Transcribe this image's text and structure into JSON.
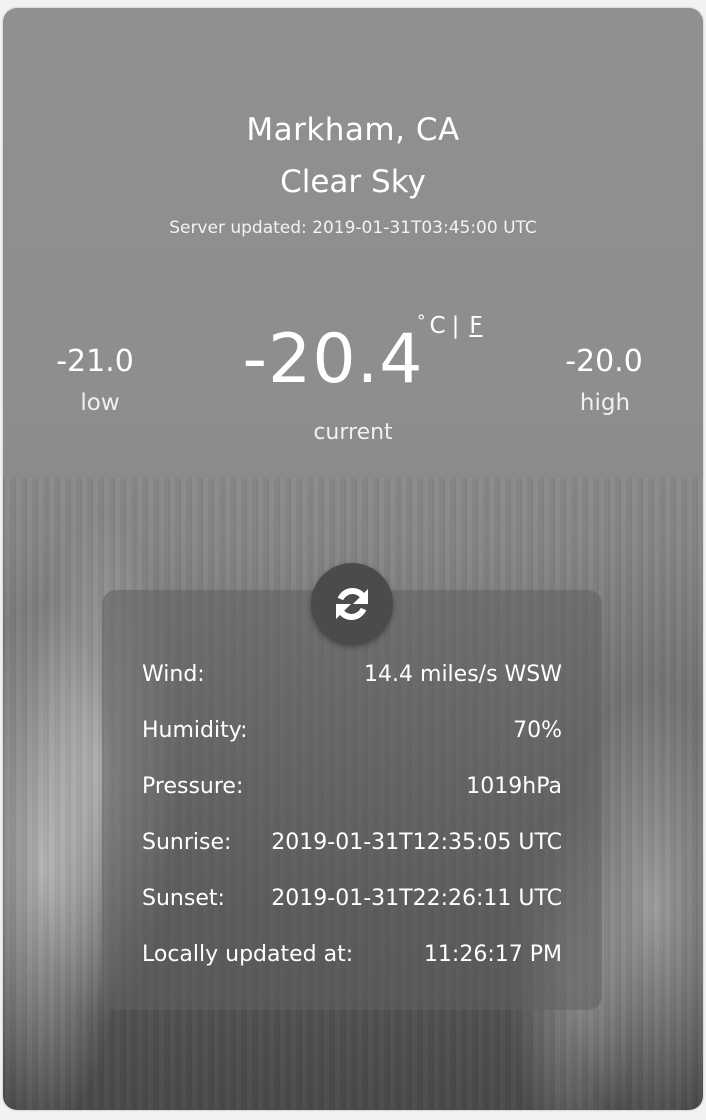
{
  "location": {
    "city": "Markham, CA",
    "condition": "Clear Sky",
    "server_updated": "Server updated: 2019-01-31T03:45:00 UTC"
  },
  "temperature": {
    "low_value": "-21.0",
    "low_label": "low",
    "current_value": "-20.4",
    "current_label": "current",
    "high_value": "-20.0",
    "high_label": "high",
    "unit_degree": "°",
    "unit_celsius": "C",
    "unit_separator": "|",
    "unit_fahrenheit": "F"
  },
  "refresh": {
    "icon": "refresh-icon"
  },
  "details": [
    {
      "label": "Wind:",
      "value": "14.4 miles/s WSW"
    },
    {
      "label": "Humidity:",
      "value": "70%"
    },
    {
      "label": "Pressure:",
      "value": "1019hPa"
    },
    {
      "label": "Sunrise:",
      "value": "2019-01-31T12:35:05 UTC"
    },
    {
      "label": "Sunset:",
      "value": "2019-01-31T22:26:11 UTC"
    },
    {
      "label": "Locally updated at:",
      "value": "11:26:17 PM"
    }
  ],
  "colors": {
    "text": "#ffffff",
    "panel": "#606060",
    "button": "#4b4b4b"
  }
}
